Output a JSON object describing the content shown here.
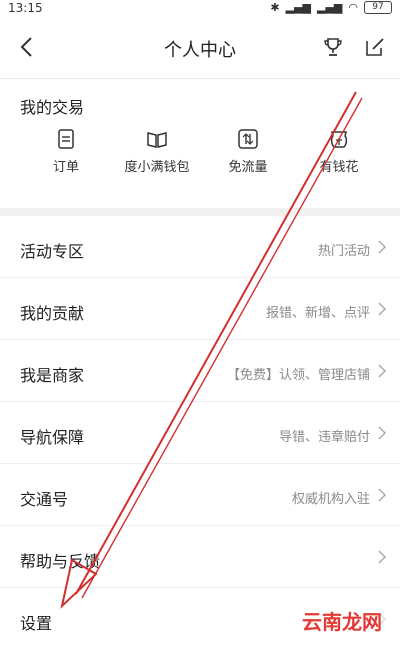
{
  "status": {
    "time": "13:15",
    "battery": "97"
  },
  "header": {
    "title": "个人中心"
  },
  "transactions": {
    "title": "我的交易",
    "items": [
      {
        "label": "订单",
        "icon": "document-icon"
      },
      {
        "label": "度小满钱包",
        "icon": "book-icon"
      },
      {
        "label": "免流量",
        "icon": "data-icon"
      },
      {
        "label": "有钱花",
        "icon": "money-icon"
      }
    ]
  },
  "list": [
    {
      "title": "活动专区",
      "desc": "热门活动"
    },
    {
      "title": "我的贡献",
      "desc": "报错、新增、点评"
    },
    {
      "title": "我是商家",
      "desc": "【免费】认领、管理店铺"
    },
    {
      "title": "导航保障",
      "desc": "导错、违章赔付"
    },
    {
      "title": "交通号",
      "desc": "权威机构入驻"
    },
    {
      "title": "帮助与反馈",
      "desc": ""
    },
    {
      "title": "设置",
      "desc": ""
    }
  ],
  "watermark": "云南龙网",
  "colors": {
    "arrow": "#d32f2f",
    "divider": "#f1f1f1",
    "secondary_text": "#8a8a8a"
  }
}
